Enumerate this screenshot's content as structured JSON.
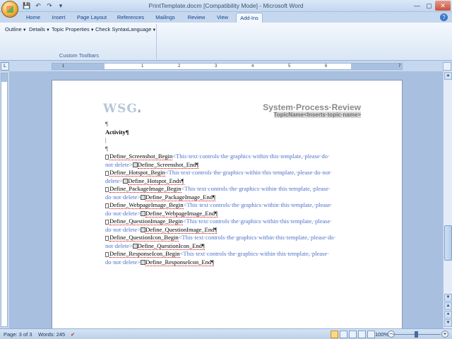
{
  "window": {
    "title": "PrintTemplate.docm [Compatibility Mode] - Microsoft Word",
    "quick_access": [
      "save-icon",
      "undo-icon",
      "redo-icon",
      "customize-icon"
    ]
  },
  "tabs": [
    {
      "label": "Home",
      "active": false
    },
    {
      "label": "Insert",
      "active": false
    },
    {
      "label": "Page Layout",
      "active": false
    },
    {
      "label": "References",
      "active": false
    },
    {
      "label": "Mailings",
      "active": false
    },
    {
      "label": "Review",
      "active": false
    },
    {
      "label": "View",
      "active": false
    },
    {
      "label": "Add-Ins",
      "active": true
    }
  ],
  "ribbon": {
    "items": [
      "Outline",
      "Details",
      "Topic Properties",
      "Check Syntax",
      "Language"
    ],
    "group_label": "Custom Toolbars"
  },
  "ruler": {
    "ticks": [
      "1",
      "1",
      "2",
      "3",
      "4",
      "5",
      "6",
      "7"
    ]
  },
  "document": {
    "logo": "WSG",
    "header_title": "System·Process·Review",
    "header_topic": "TopicName<Inserts·topic·name>",
    "heading": "Activity¶",
    "lines": [
      {
        "text": "Define_Screenshot_Begin",
        "blue": "<This·text·controls·the·graphics·within·this·template,·please·do·"
      },
      {
        "text": "",
        "blue": "not·delete>",
        "end": "Define_Screenshot_End¶"
      },
      {
        "text": "Define_Hotspot_Begin",
        "blue": "<This·text·controls·the·graphics·within·this·template,·please·do·not·"
      },
      {
        "text": "",
        "blue": "delete>",
        "end": "Define_Hotspot_Ends¶"
      },
      {
        "text": "Define_PackageImage_Begin",
        "blue": "<This·text·controls·the·graphics·within·this·template,·please·"
      },
      {
        "text": "",
        "blue": "do·not·delete>",
        "end": "Define_PackageImage_End¶"
      },
      {
        "text": "Define_WebpageImage_Begin",
        "blue": "<This·text·controls·the·graphics·within·this·template,·please·"
      },
      {
        "text": "",
        "blue": "do·not·delete>",
        "end": "Define_WebpageImage_End¶"
      },
      {
        "text": "Define_QuestionImage_Begin",
        "blue": "<This·text·controls·the·graphics·within·this·template,·please·"
      },
      {
        "text": "",
        "blue": "do·not·delete>",
        "end": "Define_QuestionImage_End¶"
      },
      {
        "text": "Define_QuestionIcon_Begin",
        "blue": "<This·text·controls·the·graphics·within·this·template,·please·do·"
      },
      {
        "text": "",
        "blue": "not·delete>",
        "end": "Define_QuestionIcon_End¶"
      },
      {
        "text": "Define_ResponseIcon_Begin",
        "blue": "<This·text·controls·the·graphics·within·this·template,·please·"
      },
      {
        "text": "",
        "blue": "do·not·delete>",
        "end": "Define_ResponseIcon_End¶"
      }
    ]
  },
  "status": {
    "page": "Page: 3 of 3",
    "words": "Words: 245",
    "zoom": "100%"
  },
  "colors": {
    "ribbon_bg": "#d9e6f5",
    "field_text": "#4a72c9",
    "doc_bg": "#a8bfe0"
  }
}
